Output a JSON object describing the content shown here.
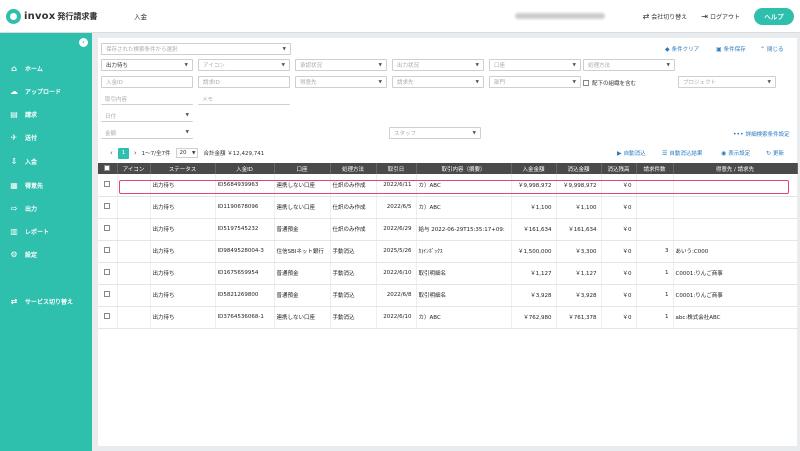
{
  "header": {
    "logo_text": "invox",
    "logo_sub": "発行請求書",
    "page_name": "入金",
    "company_name": "invoxプロフェッショナル",
    "switch_company": "会社切り替え",
    "logout": "ログアウト",
    "help": "ヘルプ"
  },
  "sidebar": {
    "items": [
      {
        "label": "ホーム",
        "icon": "home-icon",
        "glyph": "⌂"
      },
      {
        "label": "アップロード",
        "icon": "upload-icon",
        "glyph": "☁"
      },
      {
        "label": "請求",
        "icon": "invoice-icon",
        "glyph": "▤"
      },
      {
        "label": "送付",
        "icon": "send-icon",
        "glyph": "✈"
      },
      {
        "label": "入金",
        "icon": "deposit-icon",
        "glyph": "⇩"
      },
      {
        "label": "得意先",
        "icon": "customer-icon",
        "glyph": "▦"
      },
      {
        "label": "出力",
        "icon": "export-icon",
        "glyph": "⇨"
      },
      {
        "label": "レポート",
        "icon": "report-icon",
        "glyph": "▥"
      },
      {
        "label": "設定",
        "icon": "gear-icon",
        "glyph": "⚙"
      }
    ],
    "service_switch": {
      "label": "サービス切り替え",
      "icon": "service-switch-icon",
      "glyph": "⇄"
    }
  },
  "filters": {
    "saved_search_placeholder": "保存された検索条件から選択",
    "clear": "条件クリア",
    "save": "条件保存",
    "close": "閉じる",
    "status_value": "出力待ち",
    "icon_placeholder": "アイコン",
    "approval_placeholder": "承認状況",
    "output_placeholder": "出力状況",
    "account_placeholder": "口座",
    "process_placeholder": "処理方法",
    "deposit_id_placeholder": "入金ID",
    "invoice_id_placeholder": "請求ID",
    "customer_placeholder": "得意先",
    "billing_placeholder": "請求先",
    "department_placeholder": "部門",
    "include_sub_label": "配下の組織を含む",
    "project_placeholder": "プロジェクト",
    "transaction_placeholder": "取引内容",
    "memo_placeholder": "メモ",
    "date_placeholder": "日付",
    "amount_placeholder": "金額",
    "staff_placeholder": "スタッフ",
    "advanced": "詳細検索条件設定"
  },
  "pagination": {
    "current_page": "1",
    "range": "1〜7/全7件",
    "per_page": "20",
    "total": "合計金額 ￥12,429,741"
  },
  "actions": {
    "auto_clear": "自動消込",
    "auto_clear_result": "自動消込結果",
    "display_settings": "表示設定",
    "refresh": "更新"
  },
  "table": {
    "columns": [
      "アイコン",
      "ステータス",
      "入金ID",
      "口座",
      "処理方法",
      "取引日",
      "取引内容（摘要）",
      "入金金額",
      "消込金額",
      "消込残高",
      "請求件数",
      "得意先 / 請求先"
    ],
    "rows": [
      [
        "",
        "出力待ち",
        "ID5684939963",
        "連携しない口座",
        "仕訳のみ作成",
        "2022/6/11",
        "カ）ABC",
        "￥9,998,972",
        "￥9,998,972",
        "￥0",
        "",
        ""
      ],
      [
        "",
        "出力待ち",
        "ID1190678096",
        "連携しない口座",
        "仕訳のみ作成",
        "2022/6/5",
        "カ）ABC",
        "￥1,100",
        "￥1,100",
        "￥0",
        "",
        ""
      ],
      [
        "",
        "出力待ち",
        "ID5197545232",
        "普通預金",
        "仕訳のみ作成",
        "2022/6/29",
        "給与 2022-06-29T15:35:17+09:",
        "￥161,634",
        "￥161,634",
        "￥0",
        "",
        ""
      ],
      [
        "",
        "出力待ち",
        "ID9849528004-3",
        "住信SBIネット銀行",
        "手動消込",
        "2025/5/26",
        "ｶ)ｲﾝﾎﾞｯｸｽ",
        "￥1,500,000",
        "￥3,300",
        "￥0",
        "3",
        "あいう:C000"
      ],
      [
        "",
        "出力待ち",
        "ID1675659954",
        "普通預金",
        "手動消込",
        "2022/6/10",
        "取引明細名",
        "￥1,127",
        "￥1,127",
        "￥0",
        "1",
        "C0001:りんご商事"
      ],
      [
        "",
        "出力待ち",
        "ID5821269800",
        "普通預金",
        "手動消込",
        "2022/6/8",
        "取引明細名",
        "￥3,928",
        "￥3,928",
        "￥0",
        "1",
        "C0001:りんご商事"
      ],
      [
        "",
        "出力待ち",
        "ID3764536068-1",
        "連携しない口座",
        "手動消込",
        "2022/6/10",
        "カ）ABC",
        "￥762,980",
        "￥761,378",
        "￥0",
        "1",
        "abc:株式会社ABC"
      ]
    ]
  },
  "colors": {
    "accent": "#2fbfad",
    "highlight": "#e0457b",
    "link": "#2a7bc0"
  }
}
